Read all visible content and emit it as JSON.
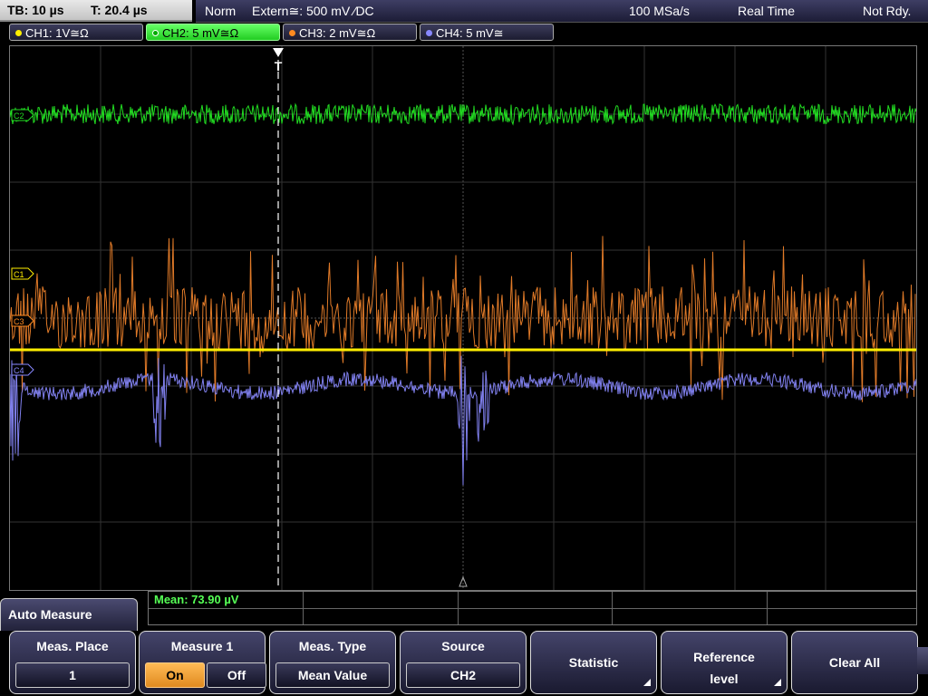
{
  "status": {
    "timebase": "TB: 10 µs",
    "trigger_time": "T: 20.4 µs",
    "mode": "Norm",
    "trigger_source": "Extern≅: 500 mV ⁄DC",
    "sample_rate": "100 MSa/s",
    "acq_mode": "Real Time",
    "trigger_state": "Not Rdy."
  },
  "channels": [
    {
      "label": "CH1: 1V≅Ω",
      "color": "#ffee00",
      "active": false
    },
    {
      "label": "CH2: 5 mV≅Ω",
      "color": "#22dd22",
      "active": true
    },
    {
      "label": "CH3: 2 mV≅Ω",
      "color": "#ff8a20",
      "active": false
    },
    {
      "label": "CH4: 5 mV≅",
      "color": "#8888ff",
      "active": false
    }
  ],
  "markers": {
    "ch2": "C2",
    "ch1": "C1",
    "ch3": "C3",
    "ch4": "C4",
    "trigger": "T"
  },
  "measurement": {
    "readout": "Mean: 73.90 µV"
  },
  "menu": {
    "title": "Auto Measure",
    "softkeys": {
      "meas_place": {
        "caption": "Meas. Place",
        "value": "1"
      },
      "measure1": {
        "caption": "Measure 1",
        "on": "On",
        "off": "Off"
      },
      "meas_type": {
        "caption": "Meas. Type",
        "value": "Mean Value"
      },
      "source": {
        "caption": "Source",
        "value": "CH2"
      },
      "statistic": {
        "label": "Statistic"
      },
      "reference": {
        "line1": "Reference",
        "line2": "level"
      },
      "clear_all": {
        "label": "Clear All"
      }
    }
  }
}
